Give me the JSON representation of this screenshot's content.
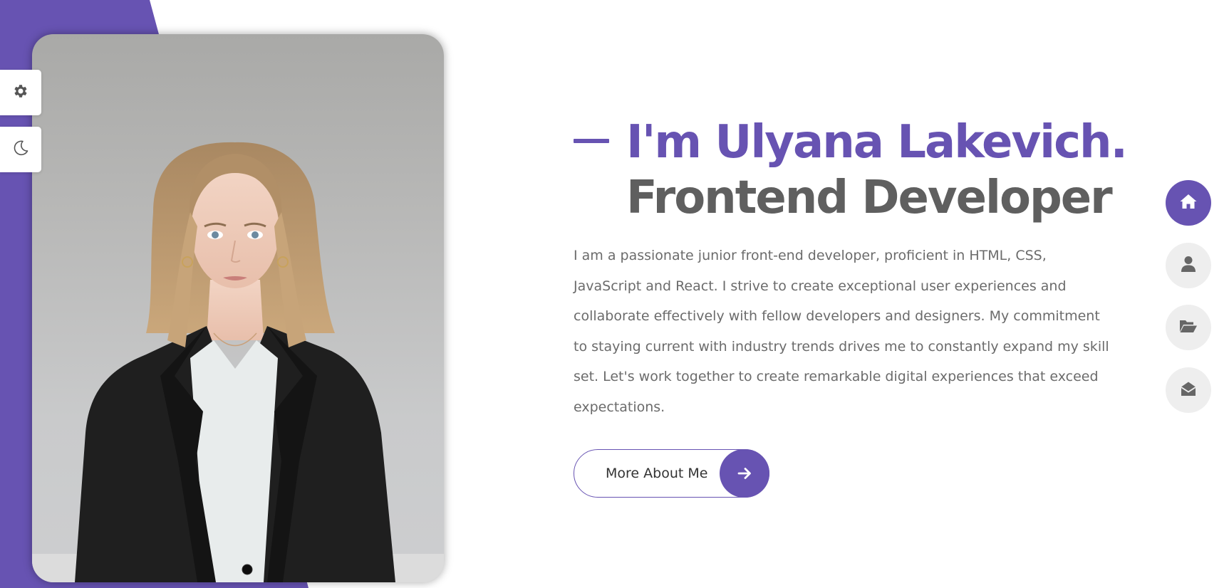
{
  "sidebar": {
    "settings_icon": "gear-icon",
    "theme_icon": "moon-icon"
  },
  "hero": {
    "name": "I'm Ulyana Lakevich.",
    "role": "Frontend Developer",
    "bio": "I am a passionate junior front-end developer, proficient in HTML, CSS, JavaScript and React. I strive to create exceptional user experiences and collaborate effectively with fellow developers and designers. My commitment to staying current with industry trends drives me to constantly expand my skill set. Let's work together to create remarkable digital experiences that exceed expectations.",
    "button_label": "More About Me",
    "button_icon": "arrow-right-icon"
  },
  "nav": [
    {
      "icon": "home-icon",
      "active": true
    },
    {
      "icon": "user-icon",
      "active": false
    },
    {
      "icon": "folder-open-icon",
      "active": false
    },
    {
      "icon": "envelope-open-icon",
      "active": false
    }
  ],
  "colors": {
    "accent": "#6753b2",
    "heading_dark": "#5f5f5f",
    "text": "#6b6b6b",
    "nav_inactive_bg": "#eeeeee"
  }
}
